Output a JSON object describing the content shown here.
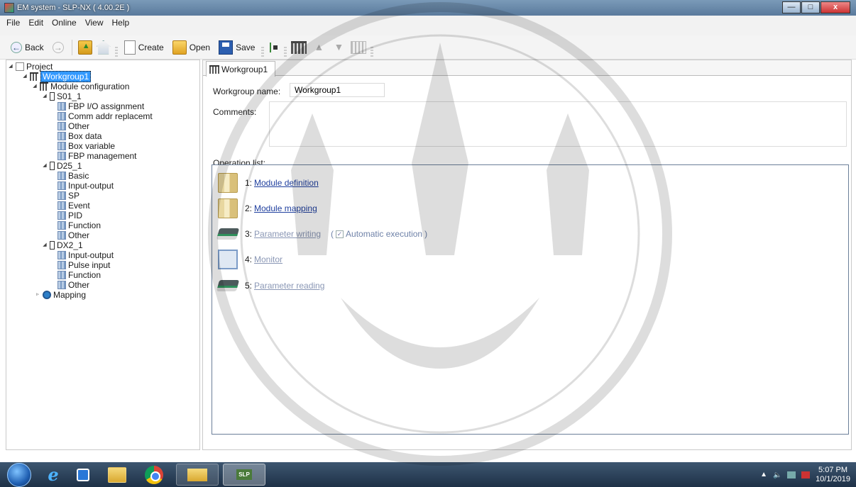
{
  "window": {
    "title": "EM system - SLP-NX ( 4.00.2E )",
    "buttons": {
      "minimize": "—",
      "maximize": "□",
      "close": "x"
    }
  },
  "menu": [
    "File",
    "Edit",
    "Online",
    "View",
    "Help"
  ],
  "toolbar": {
    "back": "Back",
    "create": "Create",
    "open": "Open",
    "save": "Save"
  },
  "tree": {
    "project": "Project",
    "workgroup": "Workgroup1",
    "module_config": "Module configuration",
    "s01": "S01_1",
    "s01_items": [
      "FBP I/O assignment",
      "Comm addr replacemt",
      "Other",
      "Box data",
      "Box variable",
      "FBP management"
    ],
    "d25": "D25_1",
    "d25_items": [
      "Basic",
      "Input-output",
      "SP",
      "Event",
      "PID",
      "Function",
      "Other"
    ],
    "dx2": "DX2_1",
    "dx2_items": [
      "Input-output",
      "Pulse input",
      "Function",
      "Other"
    ],
    "mapping": "Mapping"
  },
  "panel": {
    "tab": "Workgroup1",
    "workgroup_name_label": "Workgroup name:",
    "workgroup_name_value": "Workgroup1",
    "comments_label": "Comments:",
    "operation_list_label": "Operation list:",
    "operations": [
      {
        "num": "1:",
        "label": "Module definition",
        "enabled": true,
        "icon": "book-icon"
      },
      {
        "num": "2:",
        "label": "Module mapping",
        "enabled": true,
        "icon": "book-icon"
      },
      {
        "num": "3:",
        "label": "Parameter writing",
        "enabled": false,
        "icon": "device-icon",
        "extra_open": "(",
        "extra_label": "Automatic execution",
        "extra_close": ")",
        "checked": true
      },
      {
        "num": "4:",
        "label": "Monitor",
        "enabled": false,
        "icon": "monitor-icon"
      },
      {
        "num": "5:",
        "label": "Parameter reading",
        "enabled": false,
        "icon": "device-icon"
      }
    ]
  },
  "taskbar": {
    "time": "5:07 PM",
    "date": "10/1/2019",
    "slp_label": "SLP"
  },
  "colors": {
    "link_active": "#1f3f9e",
    "link_disabled": "#8a97b5",
    "selection": "#3399ff"
  }
}
